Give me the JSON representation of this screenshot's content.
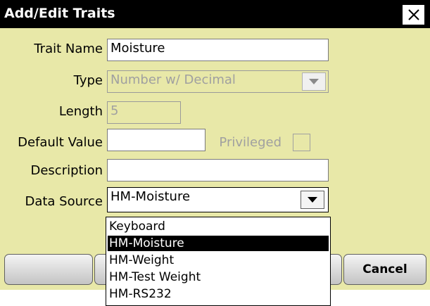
{
  "window": {
    "title": "Add/Edit Traits",
    "close_glyph": "✕"
  },
  "form": {
    "trait_name": {
      "label": "Trait Name",
      "value": "Moisture"
    },
    "type": {
      "label": "Type",
      "value": "Number w/ Decimal"
    },
    "length": {
      "label": "Length",
      "value": "5"
    },
    "default_value": {
      "label": "Default Value",
      "value": ""
    },
    "privileged": {
      "label": "Privileged",
      "checked": false
    },
    "description": {
      "label": "Description",
      "value": ""
    },
    "data_source": {
      "label": "Data Source",
      "value": "HM-Moisture",
      "options": [
        "Keyboard",
        "HM-Moisture",
        "HM-Weight",
        "HM-Test Weight",
        "HM-RS232"
      ],
      "selected_option": "HM-Moisture"
    }
  },
  "buttons": {
    "cancel_label": "Cancel"
  },
  "colors": {
    "dialog_background": "#e8e8a8",
    "titlebar": "#000000",
    "selection": "#000000"
  },
  "icons": {
    "close": "close-icon",
    "dropdown": "dropdown-arrow-icon"
  }
}
